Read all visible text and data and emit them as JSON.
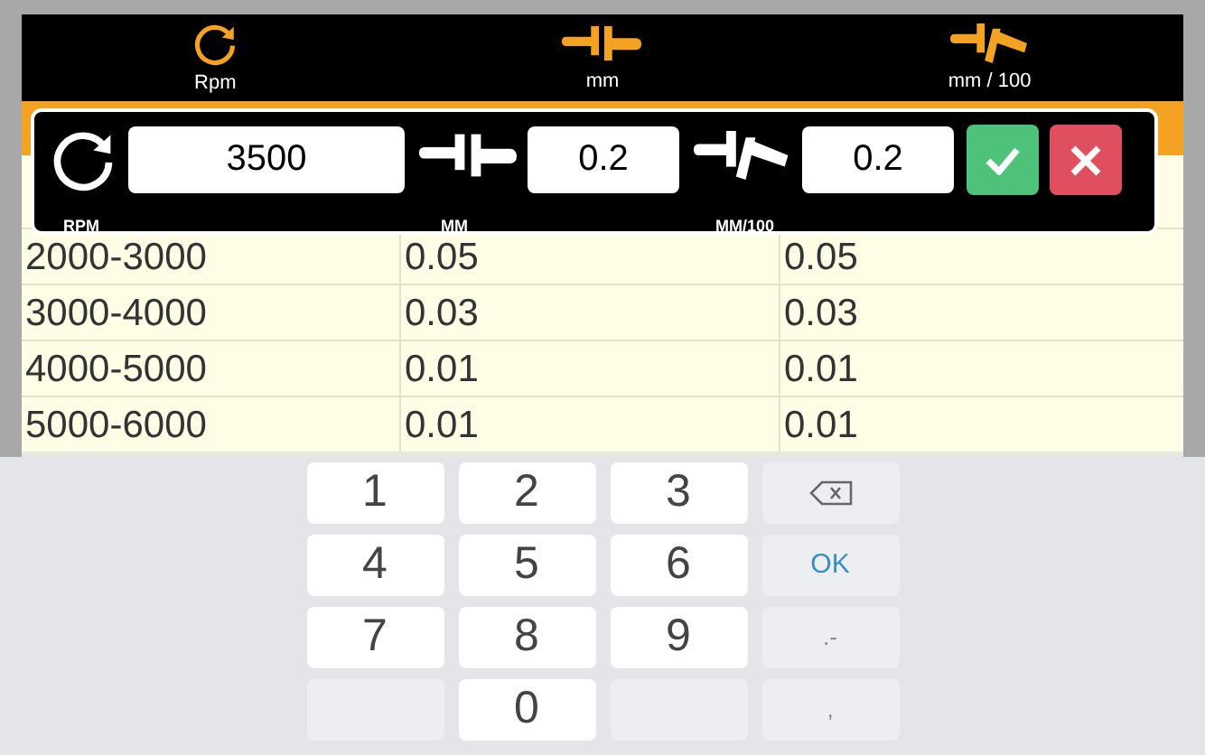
{
  "header": {
    "columns": [
      {
        "kind": "rotate",
        "label": "Rpm"
      },
      {
        "kind": "caliper",
        "label": "mm"
      },
      {
        "kind": "caliper-slant",
        "label": "mm / 100"
      }
    ]
  },
  "table": {
    "rows": [
      {
        "cells": [
          "2000-3000",
          "0.05",
          "0.05"
        ]
      },
      {
        "cells": [
          "3000-4000",
          "0.03",
          "0.03"
        ]
      },
      {
        "cells": [
          "4000-5000",
          "0.01",
          "0.01"
        ]
      },
      {
        "cells": [
          "5000-6000",
          "0.01",
          "0.01"
        ]
      }
    ]
  },
  "dialog": {
    "fields": [
      {
        "kind": "rotate",
        "value": "3500",
        "label": "RPM"
      },
      {
        "kind": "caliper",
        "value": "0.2",
        "label": "MM"
      },
      {
        "kind": "caliper-slant",
        "value": "0.2",
        "label": "MM/100"
      }
    ],
    "buttons": [
      {
        "kind": "confirm"
      },
      {
        "kind": "cancel"
      }
    ]
  },
  "keyboard": {
    "rows": [
      [
        {
          "kind": "digit",
          "label": "1"
        },
        {
          "kind": "digit",
          "label": "2"
        },
        {
          "kind": "digit",
          "label": "3"
        },
        {
          "kind": "backspace"
        }
      ],
      [
        {
          "kind": "digit",
          "label": "4"
        },
        {
          "kind": "digit",
          "label": "5"
        },
        {
          "kind": "digit",
          "label": "6"
        },
        {
          "kind": "ok",
          "label": "OK"
        }
      ],
      [
        {
          "kind": "digit",
          "label": "7"
        },
        {
          "kind": "digit",
          "label": "8"
        },
        {
          "kind": "digit",
          "label": "9"
        },
        {
          "kind": "symbol",
          "label": ".-"
        }
      ],
      [
        {
          "kind": "blank"
        },
        {
          "kind": "digit",
          "label": "0"
        },
        {
          "kind": "blank"
        },
        {
          "kind": "symbol",
          "label": ","
        }
      ]
    ]
  }
}
